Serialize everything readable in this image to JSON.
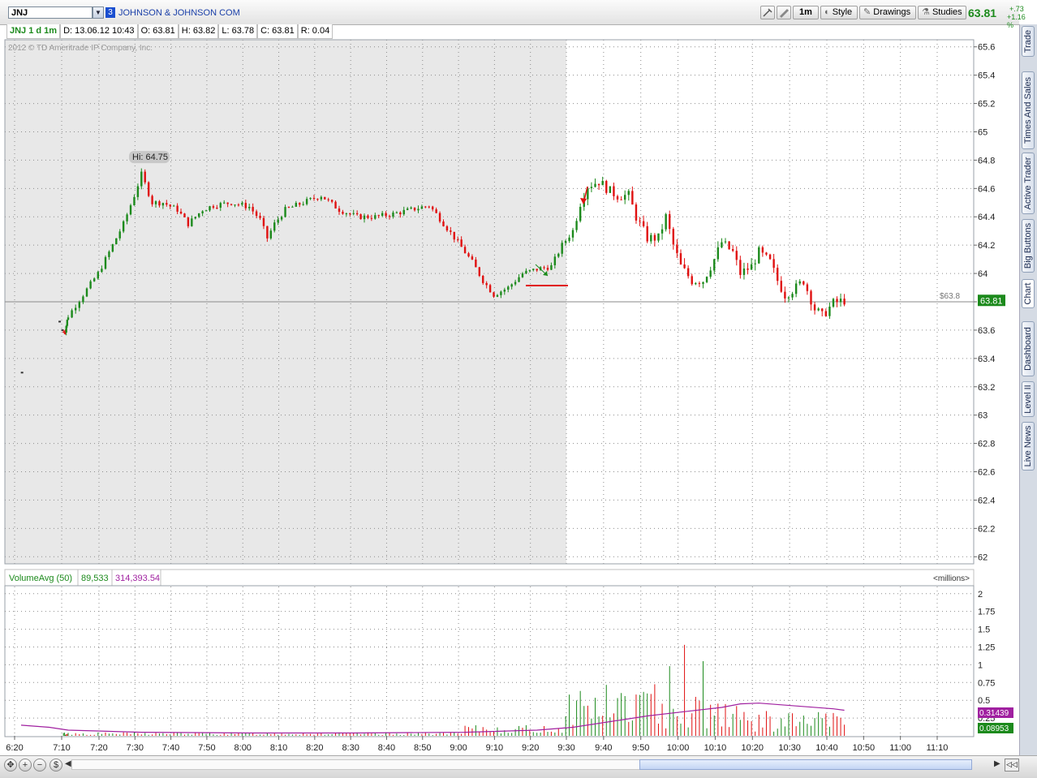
{
  "header": {
    "symbol": "JNJ",
    "link_number": "3",
    "company": "JOHNSON & JOHNSON COM",
    "buttons": {
      "interval": "1m",
      "style": "Style",
      "drawings": "Drawings",
      "studies": "Studies"
    },
    "last_price": "63.81",
    "change_abs": "+.73",
    "change_pct": "+1.16 %"
  },
  "info": {
    "title": "JNJ 1 d 1m",
    "date": "D: 13.06.12 10:43",
    "open": "O: 63.81",
    "high": "H: 63.82",
    "low": "L: 63.78",
    "close": "C: 63.81",
    "range": "R: 0.04"
  },
  "copyright": "2012 © TD Ameritrade IP Company, Inc.",
  "volume_header": {
    "study": "VolumeAvg (50)",
    "volume": "89,533",
    "avg": "314,393.54",
    "units": "<millions>"
  },
  "side_tabs": [
    "Trade",
    "Times And Sales",
    "Active Trader",
    "Big Buttons",
    "Chart",
    "Dashboard",
    "Level II",
    "Live News"
  ],
  "colors": {
    "up": "#1c8a1c",
    "down": "#e01010",
    "avg": "#a020a0",
    "premarket_bg": "#e8e8e8",
    "grid": "#8c8c8c"
  },
  "chart_data": {
    "type": "candlestick",
    "price_axis": {
      "ylim": [
        61.95,
        65.65
      ],
      "ticks": [
        "65.6",
        "65.4",
        "65.2",
        "65",
        "64.8",
        "64.6",
        "64.4",
        "64.2",
        "64",
        "63.8",
        "63.6",
        "63.4",
        "63.2",
        "63",
        "62.8",
        "62.6",
        "62.4",
        "62.2",
        "62"
      ]
    },
    "time_axis": {
      "ticks": [
        "6:20",
        "7:10",
        "7:20",
        "7:30",
        "7:40",
        "7:50",
        "8:00",
        "8:10",
        "8:20",
        "8:30",
        "8:40",
        "8:50",
        "9:00",
        "9:10",
        "9:20",
        "9:30",
        "9:40",
        "9:50",
        "10:00",
        "10:10",
        "10:20",
        "10:30",
        "10:40",
        "10:50",
        "11:00",
        "11:10"
      ]
    },
    "high_label": "Hi: 64.75",
    "high_value": 64.75,
    "last_label": "63.81",
    "last_value": 63.81,
    "reference_label": "$63.8",
    "reference_value": 63.8,
    "premarket_end": "9:30",
    "price_path": [
      [
        "6:20",
        63.3
      ],
      [
        "7:07",
        63.6
      ],
      [
        "7:10",
        63.7
      ],
      [
        "7:14",
        63.85
      ],
      [
        "7:18",
        64.0
      ],
      [
        "7:21",
        64.15
      ],
      [
        "7:25",
        64.35
      ],
      [
        "7:28",
        64.55
      ],
      [
        "7:30",
        64.7
      ],
      [
        "7:33",
        64.5
      ],
      [
        "7:36",
        64.5
      ],
      [
        "7:40",
        64.45
      ],
      [
        "7:43",
        64.35
      ],
      [
        "7:47",
        64.45
      ],
      [
        "7:50",
        64.48
      ],
      [
        "7:55",
        64.5
      ],
      [
        "8:00",
        64.47
      ],
      [
        "8:03",
        64.38
      ],
      [
        "8:05",
        64.25
      ],
      [
        "8:07",
        64.35
      ],
      [
        "8:10",
        64.45
      ],
      [
        "8:15",
        64.5
      ],
      [
        "8:20",
        64.55
      ],
      [
        "8:25",
        64.45
      ],
      [
        "8:30",
        64.4
      ],
      [
        "8:35",
        64.4
      ],
      [
        "8:40",
        64.42
      ],
      [
        "8:45",
        64.45
      ],
      [
        "8:50",
        64.48
      ],
      [
        "8:52",
        64.42
      ],
      [
        "8:55",
        64.32
      ],
      [
        "8:58",
        64.22
      ],
      [
        "9:02",
        64.08
      ],
      [
        "9:05",
        63.95
      ],
      [
        "9:08",
        63.85
      ],
      [
        "9:12",
        63.9
      ],
      [
        "9:16",
        64.0
      ],
      [
        "9:20",
        64.03
      ],
      [
        "9:24",
        64.05
      ],
      [
        "9:27",
        64.2
      ],
      [
        "9:30",
        64.3
      ],
      [
        "9:32",
        64.5
      ],
      [
        "9:34",
        64.62
      ],
      [
        "9:37",
        64.65
      ],
      [
        "9:40",
        64.58
      ],
      [
        "9:42",
        64.55
      ],
      [
        "9:45",
        64.55
      ],
      [
        "9:47",
        64.4
      ],
      [
        "9:50",
        64.25
      ],
      [
        "9:53",
        64.25
      ],
      [
        "9:55",
        64.4
      ],
      [
        "9:57",
        64.2
      ],
      [
        "9:59",
        64.05
      ],
      [
        "10:02",
        63.95
      ],
      [
        "10:05",
        63.95
      ],
      [
        "10:08",
        64.1
      ],
      [
        "10:10",
        64.22
      ],
      [
        "10:13",
        64.15
      ],
      [
        "10:15",
        64.0
      ],
      [
        "10:18",
        64.05
      ],
      [
        "10:20",
        64.15
      ],
      [
        "10:23",
        64.08
      ],
      [
        "10:25",
        63.95
      ],
      [
        "10:27",
        63.85
      ],
      [
        "10:30",
        63.9
      ],
      [
        "10:32",
        63.95
      ],
      [
        "10:35",
        63.75
      ],
      [
        "10:37",
        63.7
      ],
      [
        "10:40",
        63.79
      ],
      [
        "10:43",
        63.81
      ]
    ],
    "volume_axis": {
      "ylim": [
        0,
        2.1
      ],
      "ticks": [
        "2",
        "1.75",
        "1.5",
        "1.25",
        "1",
        "0.75",
        "0.5",
        "0.25"
      ],
      "unit": "millions"
    },
    "volume_current": "0.08953",
    "volume_avg_current": "0.31439",
    "volume_avg_path": [
      [
        "6:20",
        0.15
      ],
      [
        "6:50",
        0.12
      ],
      [
        "7:10",
        0.08
      ],
      [
        "7:30",
        0.05
      ],
      [
        "8:00",
        0.04
      ],
      [
        "8:30",
        0.04
      ],
      [
        "9:00",
        0.05
      ],
      [
        "9:20",
        0.08
      ],
      [
        "9:30",
        0.12
      ],
      [
        "9:40",
        0.2
      ],
      [
        "9:50",
        0.28
      ],
      [
        "10:00",
        0.34
      ],
      [
        "10:10",
        0.4
      ],
      [
        "10:15",
        0.45
      ],
      [
        "10:20",
        0.46
      ],
      [
        "10:30",
        0.42
      ],
      [
        "10:40",
        0.38
      ],
      [
        "10:43",
        0.36
      ]
    ]
  }
}
